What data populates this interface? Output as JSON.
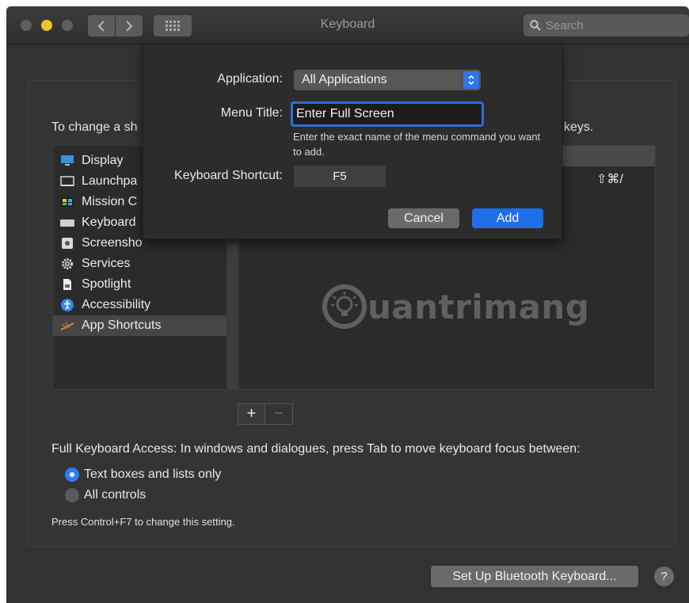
{
  "window": {
    "title": "Keyboard"
  },
  "search": {
    "placeholder": "Search"
  },
  "main": {
    "instructions_prefix": "To change a sh",
    "instructions_suffix": "keys.",
    "categories": [
      {
        "label": "Display",
        "icon": "display-icon"
      },
      {
        "label": "Launchpa",
        "icon": "launchpad-icon"
      },
      {
        "label": "Mission C",
        "icon": "mission-control-icon"
      },
      {
        "label": "Keyboard",
        "icon": "keyboard-icon"
      },
      {
        "label": "Screensho",
        "icon": "screenshot-icon"
      },
      {
        "label": "Services",
        "icon": "gear-icon"
      },
      {
        "label": "Spotlight",
        "icon": "spotlight-icon"
      },
      {
        "label": "Accessibility",
        "icon": "accessibility-icon"
      },
      {
        "label": "App Shortcuts",
        "icon": "app-shortcuts-icon",
        "selected": true
      }
    ],
    "shortcut_keys": "⇧⌘/",
    "watermark": "uantrimang",
    "plus_label": "+",
    "minus_label": "−",
    "full_keyboard_access": "Full Keyboard Access: In windows and dialogues, press Tab to move keyboard focus between:",
    "radio_options": [
      {
        "label": "Text boxes and lists only",
        "selected": true
      },
      {
        "label": "All controls",
        "selected": false
      }
    ],
    "hint": "Press Control+F7 to change this setting.",
    "bluetooth_button": "Set Up Bluetooth Keyboard...",
    "help_button": "?"
  },
  "sheet": {
    "application_label": "Application:",
    "application_value": "All Applications",
    "menu_title_label": "Menu Title:",
    "menu_title_value": "Enter Full Screen",
    "menu_help": "Enter the exact name of the menu command you want to add.",
    "shortcut_label": "Keyboard Shortcut:",
    "shortcut_value": "F5",
    "cancel_label": "Cancel",
    "add_label": "Add"
  },
  "colors": {
    "accent": "#2f74f3",
    "traffic_minimize": "#f5c02f",
    "window_bg": "#323232"
  }
}
